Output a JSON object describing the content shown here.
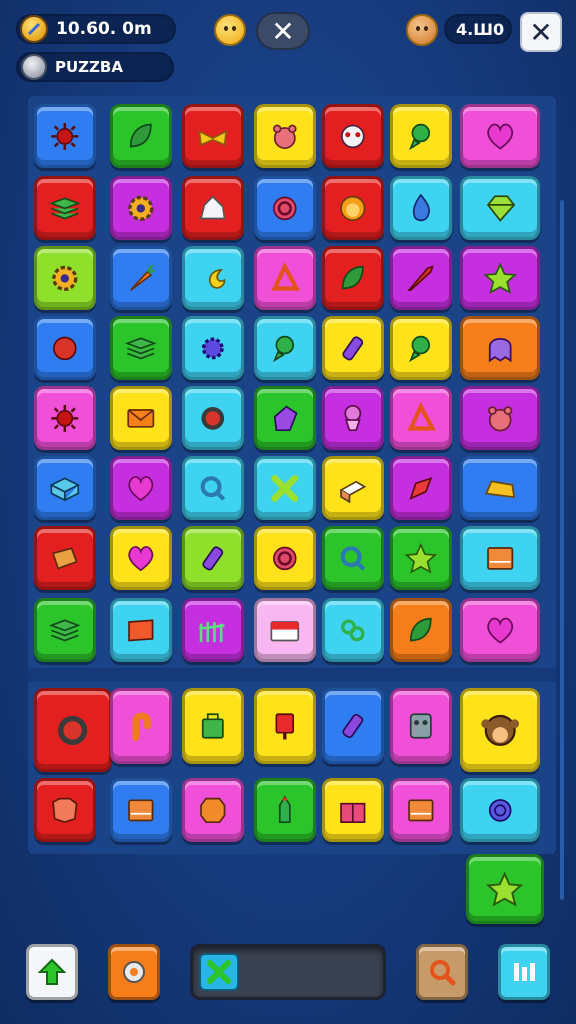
{
  "hud": {
    "coins": "10.60. 0m",
    "level_name": "PUZZBA",
    "gems": "4.Ш0"
  },
  "colors": {
    "red": "#e41f1f",
    "green": "#2bc42b",
    "yellow": "#ffe21a",
    "blue": "#2f7df0",
    "purple": "#c62fe0",
    "cyan": "#3fd3f2",
    "pink": "#f04fd8",
    "lime": "#8fe02a",
    "orange": "#f57d1a",
    "lightpink": "#f8b7f0"
  },
  "grid_rows": [
    [
      {
        "c": "blue",
        "i": "sun-icon"
      },
      {
        "c": "green",
        "i": "leaf-icon"
      },
      {
        "c": "red",
        "i": "bow-icon"
      },
      {
        "c": "yellow",
        "i": "bear-icon"
      },
      {
        "c": "red",
        "i": "mask-icon"
      },
      {
        "c": "yellow",
        "i": "pin-icon"
      },
      {
        "c": "pink",
        "i": "heart-icon"
      }
    ],
    [
      {
        "c": "red",
        "i": "layers-icon"
      },
      {
        "c": "purple",
        "i": "gear-icon"
      },
      {
        "c": "red",
        "i": "house-icon"
      },
      {
        "c": "blue",
        "i": "spiral-icon"
      },
      {
        "c": "red",
        "i": "lion-icon"
      },
      {
        "c": "cyan",
        "i": "drop-icon"
      },
      {
        "c": "cyan",
        "i": "gem-icon"
      }
    ],
    [
      {
        "c": "lime",
        "i": "gear-icon"
      },
      {
        "c": "blue",
        "i": "carrot-icon"
      },
      {
        "c": "cyan",
        "i": "moon-icon"
      },
      {
        "c": "pink",
        "i": "triangle-icon"
      },
      {
        "c": "red",
        "i": "leaf-icon"
      },
      {
        "c": "purple",
        "i": "rocket-icon"
      },
      {
        "c": "purple",
        "i": "star-icon"
      }
    ],
    [
      {
        "c": "blue",
        "i": "shield-icon"
      },
      {
        "c": "green",
        "i": "layers-icon"
      },
      {
        "c": "cyan",
        "i": "flower-icon"
      },
      {
        "c": "cyan",
        "i": "pin-icon"
      },
      {
        "c": "yellow",
        "i": "bottle-icon"
      },
      {
        "c": "yellow",
        "i": "pin-icon"
      },
      {
        "c": "orange",
        "i": "ghost-icon"
      }
    ],
    [
      {
        "c": "pink",
        "i": "sun-icon"
      },
      {
        "c": "yellow",
        "i": "envelope-icon"
      },
      {
        "c": "cyan",
        "i": "ring-icon"
      },
      {
        "c": "green",
        "i": "glove-icon"
      },
      {
        "c": "purple",
        "i": "cupcake-icon"
      },
      {
        "c": "pink",
        "i": "triangle-icon"
      },
      {
        "c": "purple",
        "i": "bear-icon"
      }
    ],
    [
      {
        "c": "blue",
        "i": "box-icon"
      },
      {
        "c": "purple",
        "i": "heart-icon"
      },
      {
        "c": "cyan",
        "i": "search-icon"
      },
      {
        "c": "cyan",
        "i": "cross-icon"
      },
      {
        "c": "yellow",
        "i": "cake-icon"
      },
      {
        "c": "purple",
        "i": "cone-icon"
      },
      {
        "c": "blue",
        "i": "cheese-icon"
      }
    ],
    [
      {
        "c": "red",
        "i": "puzzle-icon"
      },
      {
        "c": "yellow",
        "i": "heart-icon"
      },
      {
        "c": "lime",
        "i": "bottle-icon"
      },
      {
        "c": "yellow",
        "i": "spiral-icon"
      },
      {
        "c": "green",
        "i": "search-icon"
      },
      {
        "c": "green",
        "i": "star-icon"
      },
      {
        "c": "cyan",
        "i": "book-icon"
      }
    ],
    [
      {
        "c": "green",
        "i": "layers-icon"
      },
      {
        "c": "cyan",
        "i": "flag-icon"
      },
      {
        "c": "purple",
        "i": "fence-icon"
      },
      {
        "c": "lightpink",
        "i": "card-icon"
      },
      {
        "c": "cyan",
        "i": "pretzel-icon"
      },
      {
        "c": "orange",
        "i": "leaf-icon"
      },
      {
        "c": "pink",
        "i": "heart-icon"
      }
    ]
  ],
  "lower_rows": [
    [
      {
        "c": "red",
        "i": "ring-icon"
      },
      {
        "c": "pink",
        "i": "hook-icon"
      },
      {
        "c": "yellow",
        "i": "bag-icon"
      },
      {
        "c": "yellow",
        "i": "mailbox-icon"
      },
      {
        "c": "blue",
        "i": "bottle-icon"
      },
      {
        "c": "pink",
        "i": "robot-icon"
      },
      {
        "c": "yellow",
        "i": "monkey-icon"
      }
    ],
    [
      {
        "c": "red",
        "i": "cookie-icon"
      },
      {
        "c": "blue",
        "i": "book-icon"
      },
      {
        "c": "pink",
        "i": "badge-icon"
      },
      {
        "c": "green",
        "i": "tower-icon"
      },
      {
        "c": "yellow",
        "i": "gift-icon"
      },
      {
        "c": "pink",
        "i": "book-icon"
      },
      {
        "c": "cyan",
        "i": "snail-icon"
      }
    ]
  ],
  "extra_tile": {
    "c": "green",
    "i": "star-icon"
  },
  "bottom_bar": {
    "home": {
      "c": "#f4f6fa",
      "i": "arrow-up-icon"
    },
    "settings": {
      "c": "#f57d1a",
      "i": "gear-icon"
    },
    "tray_slot": {
      "c": "#29b6e6",
      "i": "cross-icon"
    },
    "search": {
      "c": "#c79a6a",
      "i": "search-icon"
    },
    "stats": {
      "c": "#3fd3f2",
      "i": "bars-icon"
    }
  }
}
